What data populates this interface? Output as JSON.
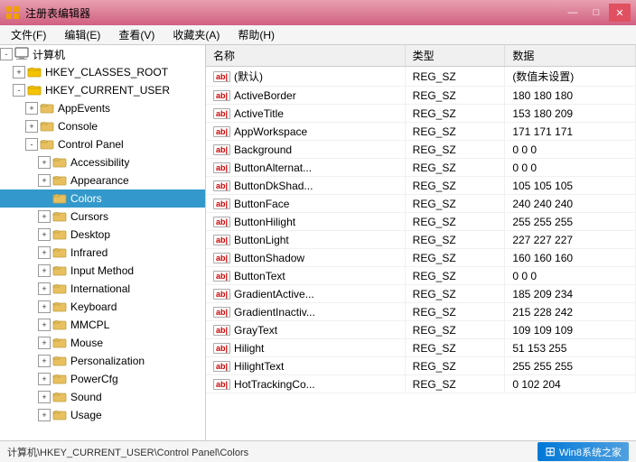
{
  "titleBar": {
    "title": "注册表编辑器",
    "minBtn": "—",
    "maxBtn": "□",
    "closeBtn": "✕"
  },
  "menuBar": {
    "items": [
      "文件(F)",
      "编辑(E)",
      "查看(V)",
      "收藏夹(A)",
      "帮助(H)"
    ]
  },
  "tree": {
    "nodes": [
      {
        "id": "computer",
        "label": "计算机",
        "indent": 0,
        "expand": "-",
        "type": "computer",
        "expanded": true
      },
      {
        "id": "classes_root",
        "label": "HKEY_CLASSES_ROOT",
        "indent": 1,
        "expand": "+",
        "type": "hive",
        "expanded": false
      },
      {
        "id": "current_user",
        "label": "HKEY_CURRENT_USER",
        "indent": 1,
        "expand": "-",
        "type": "hive",
        "expanded": true
      },
      {
        "id": "appevents",
        "label": "AppEvents",
        "indent": 2,
        "expand": "+",
        "type": "folder",
        "expanded": false
      },
      {
        "id": "console",
        "label": "Console",
        "indent": 2,
        "expand": "+",
        "type": "folder",
        "expanded": false
      },
      {
        "id": "controlpanel",
        "label": "Control Panel",
        "indent": 2,
        "expand": "-",
        "type": "folder",
        "expanded": true
      },
      {
        "id": "accessibility",
        "label": "Accessibility",
        "indent": 3,
        "expand": "+",
        "type": "folder",
        "expanded": false
      },
      {
        "id": "appearance",
        "label": "Appearance",
        "indent": 3,
        "expand": "+",
        "type": "folder",
        "expanded": false
      },
      {
        "id": "colors",
        "label": "Colors",
        "indent": 3,
        "expand": null,
        "type": "folder",
        "expanded": false,
        "selected": true
      },
      {
        "id": "cursors",
        "label": "Cursors",
        "indent": 3,
        "expand": "+",
        "type": "folder",
        "expanded": false
      },
      {
        "id": "desktop",
        "label": "Desktop",
        "indent": 3,
        "expand": "+",
        "type": "folder",
        "expanded": false
      },
      {
        "id": "infrared",
        "label": "Infrared",
        "indent": 3,
        "expand": "+",
        "type": "folder",
        "expanded": false
      },
      {
        "id": "inputmethod",
        "label": "Input Method",
        "indent": 3,
        "expand": "+",
        "type": "folder",
        "expanded": false
      },
      {
        "id": "international",
        "label": "International",
        "indent": 3,
        "expand": "+",
        "type": "folder",
        "expanded": false
      },
      {
        "id": "keyboard",
        "label": "Keyboard",
        "indent": 3,
        "expand": "+",
        "type": "folder",
        "expanded": false
      },
      {
        "id": "mmcpl",
        "label": "MMCPL",
        "indent": 3,
        "expand": "+",
        "type": "folder",
        "expanded": false
      },
      {
        "id": "mouse",
        "label": "Mouse",
        "indent": 3,
        "expand": "+",
        "type": "folder",
        "expanded": false
      },
      {
        "id": "personalization",
        "label": "Personalization",
        "indent": 3,
        "expand": "+",
        "type": "folder",
        "expanded": false
      },
      {
        "id": "powercfg",
        "label": "PowerCfg",
        "indent": 3,
        "expand": "+",
        "type": "folder",
        "expanded": false
      },
      {
        "id": "sound",
        "label": "Sound",
        "indent": 3,
        "expand": "+",
        "type": "folder",
        "expanded": false
      },
      {
        "id": "usage",
        "label": "Usage",
        "indent": 3,
        "expand": "+",
        "type": "folder",
        "expanded": false
      }
    ]
  },
  "table": {
    "columns": [
      "名称",
      "类型",
      "数据"
    ],
    "rows": [
      {
        "name": "(默认)",
        "type": "REG_SZ",
        "data": "(数值未设置)"
      },
      {
        "name": "ActiveBorder",
        "type": "REG_SZ",
        "data": "180 180 180"
      },
      {
        "name": "ActiveTitle",
        "type": "REG_SZ",
        "data": "153 180 209"
      },
      {
        "name": "AppWorkspace",
        "type": "REG_SZ",
        "data": "171 171 171"
      },
      {
        "name": "Background",
        "type": "REG_SZ",
        "data": "0 0 0"
      },
      {
        "name": "ButtonAlternat...",
        "type": "REG_SZ",
        "data": "0 0 0"
      },
      {
        "name": "ButtonDkShad...",
        "type": "REG_SZ",
        "data": "105 105 105"
      },
      {
        "name": "ButtonFace",
        "type": "REG_SZ",
        "data": "240 240 240"
      },
      {
        "name": "ButtonHilight",
        "type": "REG_SZ",
        "data": "255 255 255"
      },
      {
        "name": "ButtonLight",
        "type": "REG_SZ",
        "data": "227 227 227"
      },
      {
        "name": "ButtonShadow",
        "type": "REG_SZ",
        "data": "160 160 160"
      },
      {
        "name": "ButtonText",
        "type": "REG_SZ",
        "data": "0 0 0"
      },
      {
        "name": "GradientActive...",
        "type": "REG_SZ",
        "data": "185 209 234"
      },
      {
        "name": "GradientInactiv...",
        "type": "REG_SZ",
        "data": "215 228 242"
      },
      {
        "name": "GrayText",
        "type": "REG_SZ",
        "data": "109 109 109"
      },
      {
        "name": "Hilight",
        "type": "REG_SZ",
        "data": "51 153 255"
      },
      {
        "name": "HilightText",
        "type": "REG_SZ",
        "data": "255 255 255"
      },
      {
        "name": "HotTrackingCo...",
        "type": "REG_SZ",
        "data": "0 102 204"
      }
    ]
  },
  "statusBar": {
    "path": "计算机\\HKEY_CURRENT_USER\\Control Panel\\Colors",
    "brand": "Win8系统之家"
  }
}
